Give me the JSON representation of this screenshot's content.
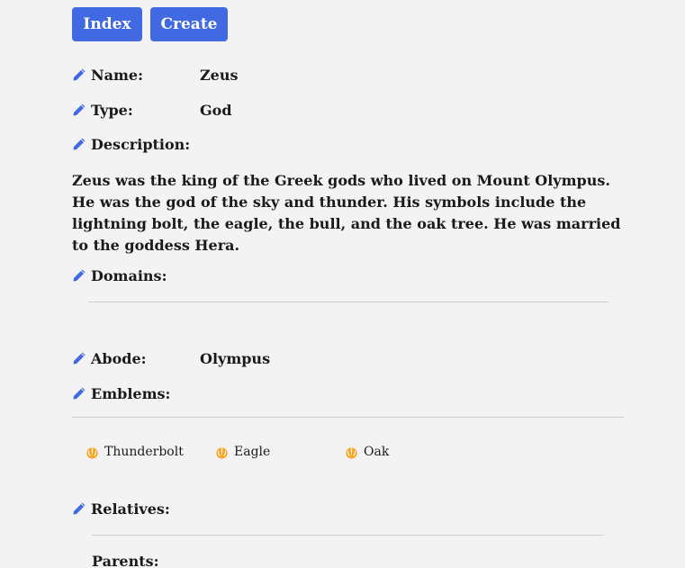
{
  "toolbar": {
    "index_label": "Index",
    "create_label": "Create"
  },
  "fields": {
    "name": {
      "label": "Name:",
      "value": "Zeus"
    },
    "type": {
      "label": "Type:",
      "value": "God"
    },
    "description": {
      "label": "Description:",
      "value": "Zeus was the king of the Greek gods who lived on Mount Olympus. He was the god of the sky and thunder. His symbols include the lightning bolt, the eagle, the bull, and the oak tree. He was married to the goddess Hera."
    },
    "domains": {
      "label": "Domains:"
    },
    "abode": {
      "label": "Abode:",
      "value": "Olympus"
    },
    "emblems": {
      "label": "Emblems:",
      "items": [
        "Thunderbolt",
        "Eagle",
        "Oak"
      ]
    },
    "relatives": {
      "label": "Relatives:",
      "parents_label": "Parents:"
    }
  },
  "icons": {
    "edit": "pencil-icon",
    "emblem": "jedi-emblem-icon"
  },
  "colors": {
    "accent": "#4169e1",
    "emblem": "#f5a623",
    "background": "#f3f3f3"
  }
}
